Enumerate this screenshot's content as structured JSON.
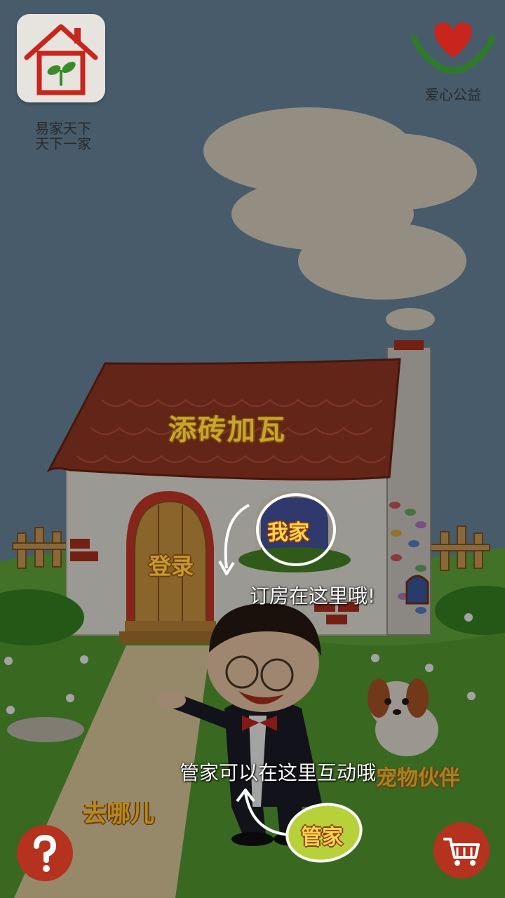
{
  "top_left": {
    "line1": "易家天下",
    "line2": "天下一家",
    "icon": "house-sprout-icon"
  },
  "top_right": {
    "label": "爱心公益",
    "icon": "heart-hands-icon"
  },
  "house": {
    "title": "添砖加瓦",
    "door_label": "登录",
    "window_badge": "我家"
  },
  "hints": {
    "window_hint": "订房在这里哦!",
    "butler_hint": "管家可以在这里互动哦"
  },
  "butler_badge": "管家",
  "path_label": "去哪儿",
  "pet_label": "宠物伙伴",
  "buttons": {
    "help_icon": "question-icon",
    "cart_icon": "shopping-cart-icon"
  },
  "colors": {
    "roof": "#9c3b24",
    "grass": "#5aa63a",
    "accent_red": "#b5321e",
    "overlay": "rgba(0,0,0,0.36)"
  }
}
